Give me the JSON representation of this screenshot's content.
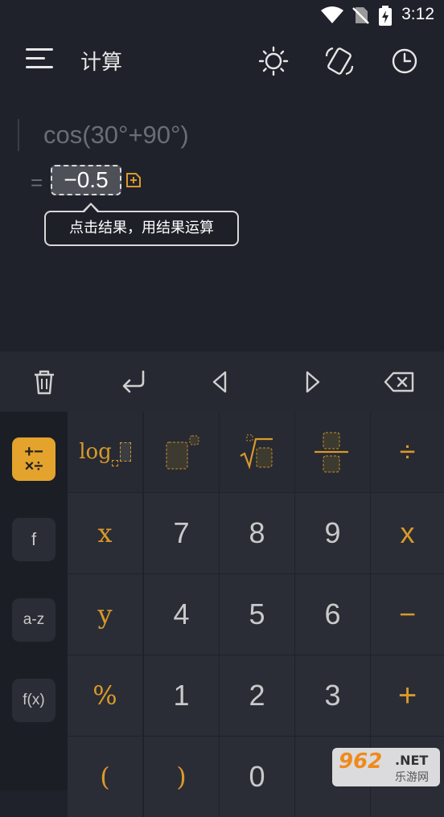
{
  "status": {
    "time": "3:12"
  },
  "header": {
    "title": "计算",
    "icons": [
      "menu-icon",
      "theme-sun-icon",
      "screen-rotate-icon",
      "history-clock-icon"
    ]
  },
  "display": {
    "expression": "cos(30°+90°)",
    "equals": "=",
    "result": "−0.5",
    "tooltip": "点击结果，用结果运算"
  },
  "toolbar": {
    "icons": [
      "trash-icon",
      "enter-icon",
      "cursor-left-icon",
      "cursor-right-icon",
      "backspace-icon"
    ]
  },
  "sidebar": {
    "items": [
      {
        "label": "+−\n×÷",
        "active": true
      },
      {
        "label": "f"
      },
      {
        "label": "a-z"
      },
      {
        "label": "f(x)"
      }
    ]
  },
  "keys": {
    "log": "log",
    "x": "x",
    "y": "y",
    "percent": "%",
    "lparen": "(",
    "rparen": ")",
    "n7": "7",
    "n8": "8",
    "n9": "9",
    "n4": "4",
    "n5": "5",
    "n6": "6",
    "n1": "1",
    "n2": "2",
    "n3": "3",
    "n0": "0",
    "divide": "÷",
    "multiply": "x",
    "minus": "−",
    "plus": "+"
  },
  "watermark": {
    "big": "962",
    "net": ".NET",
    "cn": "乐游网"
  },
  "colors": {
    "accent": "#e3a32c",
    "background": "#1f222b",
    "key": "#2a2d35"
  }
}
